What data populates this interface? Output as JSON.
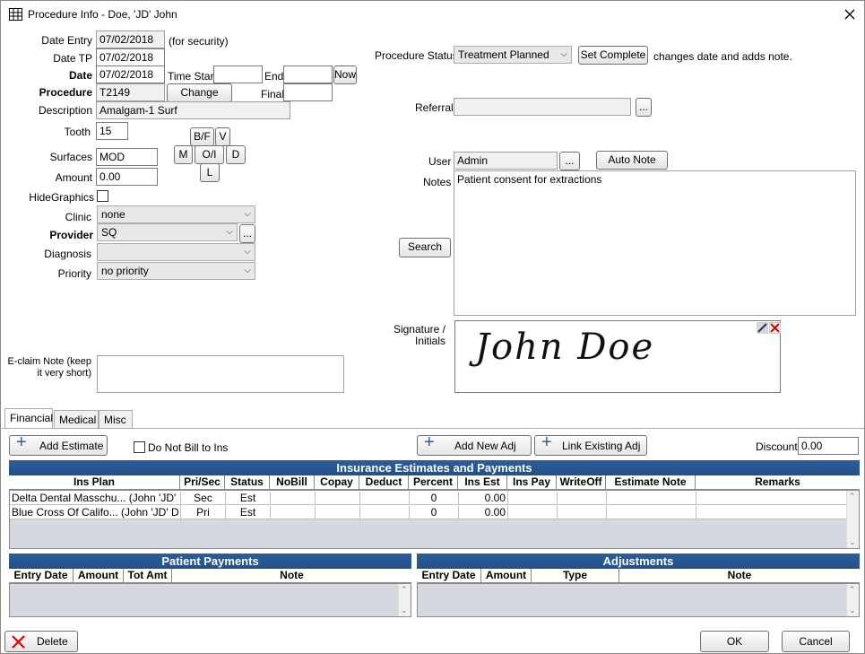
{
  "window": {
    "title": "Procedure Info - Doe, 'JD' John"
  },
  "form": {
    "date_entry_label": "Date Entry",
    "date_entry": "07/02/2018",
    "for_security": "(for security)",
    "date_tp_label": "Date TP",
    "date_tp": "07/02/2018",
    "date_label": "Date",
    "date": "07/02/2018",
    "time_start_label": "Time Start",
    "end_label": "End",
    "now_btn": "Now",
    "procedure_label": "Procedure",
    "procedure": "T2149",
    "change_btn": "Change",
    "final_label": "Final",
    "description_label": "Description",
    "description": "Amalgam-1 Surf",
    "tooth_label": "Tooth",
    "tooth": "15",
    "surfaces_label": "Surfaces",
    "surfaces": "MOD",
    "amount_label": "Amount",
    "amount": "0.00",
    "surf_btns": {
      "bf": "B/F",
      "v": "V",
      "m": "M",
      "oi": "O/I",
      "d": "D",
      "l": "L"
    },
    "hide_graphics_label": "HideGraphics",
    "clinic_label": "Clinic",
    "clinic": "none",
    "provider_label": "Provider",
    "provider": "SQ",
    "diagnosis_label": "Diagnosis",
    "diagnosis": "",
    "priority_label": "Priority",
    "priority": "no priority",
    "eclaim_label_1": "E-claim Note (keep",
    "eclaim_label_2": "it very short)",
    "proc_status_label": "Procedure Status",
    "proc_status": "Treatment Planned",
    "set_complete_btn": "Set Complete",
    "set_complete_note": "changes date and adds note.",
    "referral_label": "Referral",
    "user_label": "User",
    "user": "Admin",
    "auto_note_btn": "Auto Note",
    "notes_label": "Notes",
    "notes": "Patient consent for extractions",
    "search_btn": "Search",
    "signature_label_1": "Signature /",
    "signature_label_2": "Initials",
    "signature_text": "John Doe",
    "ellipsis": "..."
  },
  "tabs": [
    "Financial",
    "Medical",
    "Misc"
  ],
  "financial": {
    "add_estimate_btn": "Add Estimate",
    "do_not_bill_label": "Do Not Bill to Ins",
    "add_new_adj_btn": "Add New Adj",
    "link_existing_adj_btn": "Link Existing Adj",
    "discount_label": "Discount",
    "discount": "0.00",
    "ins_grid_title": "Insurance Estimates and Payments",
    "ins_columns": [
      "Ins Plan",
      "Pri/Sec",
      "Status",
      "NoBill",
      "Copay",
      "Deduct",
      "Percent",
      "Ins Est",
      "Ins Pay",
      "WriteOff",
      "Estimate Note",
      "Remarks"
    ],
    "ins_rows": [
      [
        "Delta Dental Masschu... (John 'JD'",
        "Sec",
        "Est",
        "",
        "",
        "",
        "0",
        "0.00",
        "",
        "",
        "",
        ""
      ],
      [
        "Blue Cross Of Califo... (John 'JD' D",
        "Pri",
        "Est",
        "",
        "",
        "",
        "0",
        "0.00",
        "",
        "",
        "",
        ""
      ]
    ],
    "pat_pay_title": "Patient Payments",
    "pat_pay_columns": [
      "Entry Date",
      "Amount",
      "Tot Amt",
      "Note"
    ],
    "adj_title": "Adjustments",
    "adj_columns": [
      "Entry Date",
      "Amount",
      "Type",
      "Note"
    ]
  },
  "bottom": {
    "delete_btn": "Delete",
    "ok_btn": "OK",
    "cancel_btn": "Cancel"
  },
  "colors": {
    "grid_header": "#2c5d9a",
    "delete_x": "#d00000"
  }
}
